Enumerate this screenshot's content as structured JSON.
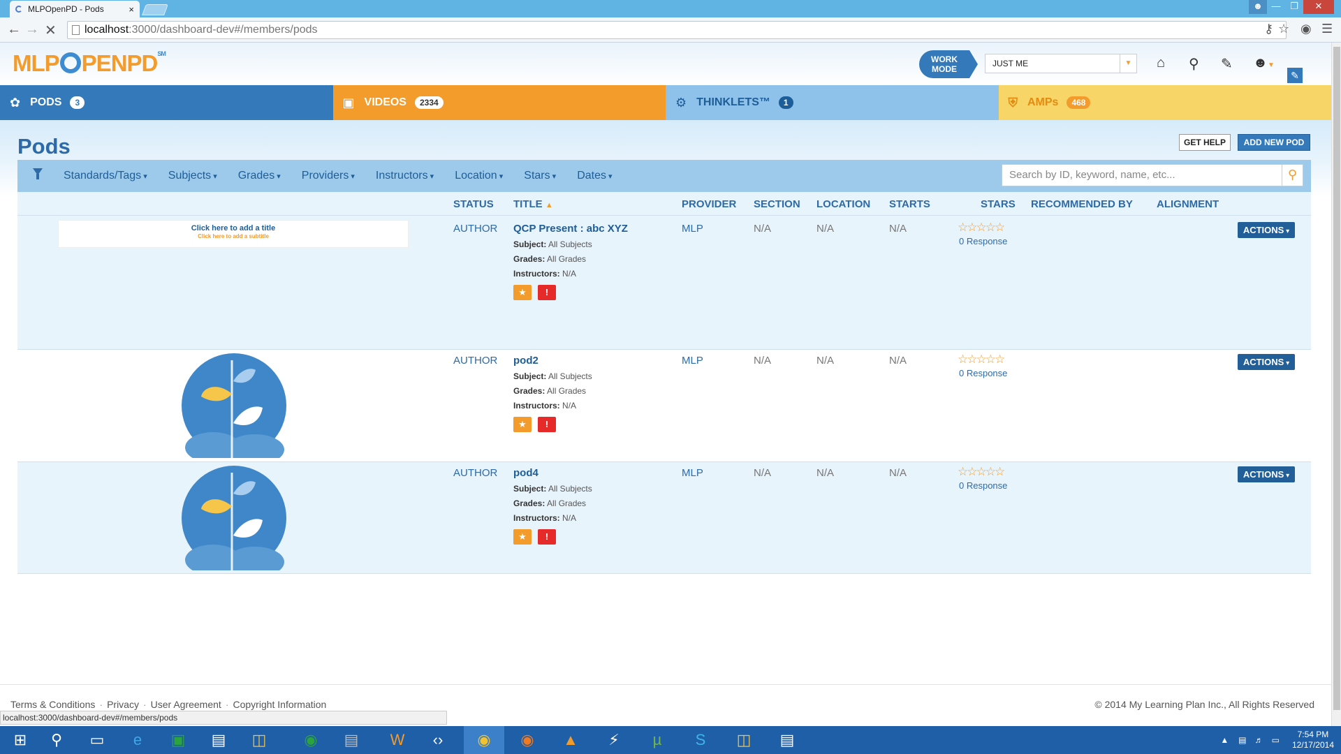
{
  "browser": {
    "tab_title": "MLPOpenPD - Pods",
    "tab_close": "×",
    "url_host": "localhost",
    "url_path": ":3000/dashboard-dev#/members/pods",
    "status_url": "localhost:3000/dashboard-dev#/members/pods"
  },
  "header": {
    "logo_mlp": "MLP",
    "logo_open": "PENPD",
    "logo_sm": "SM",
    "work_mode": "WORK MODE",
    "work_mode_select": "JUST ME"
  },
  "main_tabs": [
    {
      "label": "PODS",
      "count": "3",
      "icon": "leaf-icon"
    },
    {
      "label": "VIDEOS",
      "count": "2334",
      "icon": "film-icon"
    },
    {
      "label": "THINKLETS™",
      "count": "1",
      "icon": "gears-icon"
    },
    {
      "label": "AMPs",
      "count": "468",
      "icon": "shield-icon"
    }
  ],
  "page": {
    "title": "Pods",
    "get_help": "GET HELP",
    "add_new_pod": "ADD NEW POD"
  },
  "filters": [
    "Standards/Tags",
    "Subjects",
    "Grades",
    "Providers",
    "Instructors",
    "Location",
    "Stars",
    "Dates"
  ],
  "search": {
    "placeholder": "Search by ID, keyword, name, etc..."
  },
  "table": {
    "columns": [
      "STATUS",
      "TITLE",
      "PROVIDER",
      "SECTION",
      "LOCATION",
      "STARTS",
      "STARS",
      "RECOMMENDED BY",
      "ALIGNMENT"
    ],
    "labels": {
      "subject": "Subject:",
      "grades": "Grades:",
      "instructors": "Instructors:",
      "actions": "ACTIONS"
    },
    "rows": [
      {
        "status": "AUTHOR",
        "title": "QCP Present : abc XYZ",
        "subject": "All Subjects",
        "grades": "All Grades",
        "instructors": "N/A",
        "provider": "MLP",
        "section": "N/A",
        "location": "N/A",
        "starts": "N/A",
        "stars": 0,
        "responses": "0 Response",
        "thumb_title": "Click here to add a title",
        "thumb_subtitle": "Click here to add a subtitle"
      },
      {
        "status": "AUTHOR",
        "title": "pod2",
        "subject": "All Subjects",
        "grades": "All Grades",
        "instructors": "N/A",
        "provider": "MLP",
        "section": "N/A",
        "location": "N/A",
        "starts": "N/A",
        "stars": 0,
        "responses": "0 Response"
      },
      {
        "status": "AUTHOR",
        "title": "pod4",
        "subject": "All Subjects",
        "grades": "All Grades",
        "instructors": "N/A",
        "provider": "MLP",
        "section": "N/A",
        "location": "N/A",
        "starts": "N/A",
        "stars": 0,
        "responses": "0 Response"
      }
    ]
  },
  "footer": {
    "links": [
      "Terms & Conditions",
      "Privacy",
      "User Agreement",
      "Copyright Information"
    ],
    "copyright": "© 2014 My Learning Plan Inc., All Rights Reserved"
  },
  "taskbar": {
    "time": "7:54 PM",
    "date": "12/17/2014"
  },
  "colors": {
    "brand_blue": "#3479ba",
    "brand_orange": "#f39b2b",
    "alert_red": "#e62a2a"
  }
}
